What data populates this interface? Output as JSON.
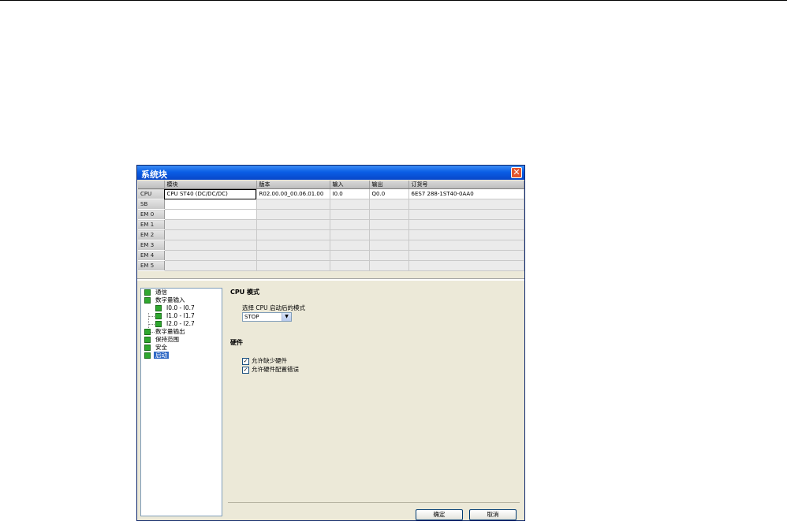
{
  "window": {
    "title": "系统块"
  },
  "table": {
    "headers": [
      "",
      "模块",
      "版本",
      "输入",
      "输出",
      "订货号"
    ],
    "rows": [
      {
        "slot": "CPU",
        "module": "CPU ST40 (DC/DC/DC)",
        "version": "R02.00.00_00.06.01.00",
        "input": "I0.0",
        "output": "Q0.0",
        "order": "6ES7 288-1ST40-0AA0"
      },
      {
        "slot": "SB",
        "module": "",
        "version": "",
        "input": "",
        "output": "",
        "order": ""
      },
      {
        "slot": "EM 0",
        "module": "",
        "version": "",
        "input": "",
        "output": "",
        "order": ""
      },
      {
        "slot": "EM 1",
        "module": "",
        "version": "",
        "input": "",
        "output": "",
        "order": ""
      },
      {
        "slot": "EM 2",
        "module": "",
        "version": "",
        "input": "",
        "output": "",
        "order": ""
      },
      {
        "slot": "EM 3",
        "module": "",
        "version": "",
        "input": "",
        "output": "",
        "order": ""
      },
      {
        "slot": "EM 4",
        "module": "",
        "version": "",
        "input": "",
        "output": "",
        "order": ""
      },
      {
        "slot": "EM 5",
        "module": "",
        "version": "",
        "input": "",
        "output": "",
        "order": ""
      }
    ]
  },
  "tree": {
    "items": [
      {
        "label": "通信"
      },
      {
        "label": "数字量输入"
      },
      {
        "label": "I0.0 - I0.7"
      },
      {
        "label": "I1.0 - I1.7"
      },
      {
        "label": "I2.0 - I2.7"
      },
      {
        "label": "数字量输出"
      },
      {
        "label": "保持范围"
      },
      {
        "label": "安全"
      },
      {
        "label": "启动"
      }
    ]
  },
  "panel": {
    "cpu_mode_title": "CPU 模式",
    "startup_label": "选择 CPU 启动后的模式",
    "startup_value": "STOP",
    "hardware_title": "硬件",
    "checkboxes": [
      {
        "label": "允许缺少硬件",
        "checked": true
      },
      {
        "label": "允许硬件配置错误",
        "checked": true
      }
    ]
  },
  "buttons": {
    "ok": "确定",
    "cancel": "取消"
  },
  "colors": {
    "title_bar": "#0a5ee6",
    "selection": "#316ac5",
    "tree_icon": "#2fa82f",
    "close": "#e3552f"
  }
}
